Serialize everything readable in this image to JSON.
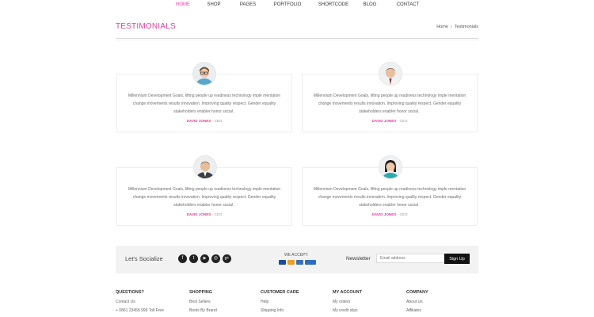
{
  "nav": {
    "items": [
      {
        "label": "HOME",
        "active": true
      },
      {
        "label": "SHOP",
        "active": false
      },
      {
        "label": "PAGES",
        "active": false
      },
      {
        "label": "PORTFOLIO",
        "active": false
      },
      {
        "label": "SHORTCODE",
        "active": false
      },
      {
        "label": "BLOG",
        "active": false
      },
      {
        "label": "CONTACT",
        "active": false
      }
    ]
  },
  "header": {
    "title": "TESTIMONIALS",
    "breadcrumb": [
      "Home",
      "Testimonials"
    ],
    "breadcrumb_separator": "›"
  },
  "testimonials": [
    {
      "avatar": "woman-with-glasses-avatar",
      "text": "Millennium Development Goals, lifting people up readiness technology imple mentation change movements results innovation. Improving quality respect. Gender equality stakeholders enabler honor social .",
      "name": "DAVID JONES",
      "role": "- CEO"
    },
    {
      "avatar": "man-in-tie-avatar",
      "text": "Millennium Development Goals, lifting people up readiness technology imple mentation change movements results innovation. Improving quality respect. Gender equality stakeholders enabler honor social .",
      "name": "DAVID JONES",
      "role": "- CEO"
    },
    {
      "avatar": "man-in-suit-avatar",
      "text": "Millennium Development Goals, lifting people up readiness technology imple mentation change movements results innovation. Improving quality respect. Gender equality stakeholders enabler honor social .",
      "name": "DAVID JONES",
      "role": "- CEO"
    },
    {
      "avatar": "woman-smiling-avatar",
      "text": "Millennium Development Goals, lifting people up readiness technology imple mentation change movements results innovation. Improving quality respect. Gender equality stakeholders enabler honor social .",
      "name": "DAVID JONES",
      "role": "- CEO"
    }
  ],
  "social_bar": {
    "socialize_label": "Let's Socialize",
    "icons": [
      {
        "name": "facebook-icon",
        "glyph": "f"
      },
      {
        "name": "twitter-icon",
        "glyph": "t"
      },
      {
        "name": "youtube-icon",
        "glyph": "▶"
      },
      {
        "name": "instagram-icon",
        "glyph": "◎"
      },
      {
        "name": "google-plus-icon",
        "glyph": "g+"
      }
    ],
    "accept_label": "WE ACCEPT:",
    "payment_icons": [
      "visa-icon",
      "mastercard-icon",
      "discover-icon",
      "paypal-icon"
    ],
    "newsletter_label": "Newsletter",
    "email_placeholder": "Email address",
    "signup_label": "Sign Up"
  },
  "footer": {
    "columns": [
      {
        "heading": "QUESTIONS?",
        "links": [
          "Contact Us",
          "+ 0861 23456 999 Toll Free"
        ]
      },
      {
        "heading": "SHOPPING",
        "links": [
          "Best Sellers",
          "Boots By Brand"
        ]
      },
      {
        "heading": "CUSTOMER CARE",
        "links": [
          "Help",
          "Shipping Info"
        ]
      },
      {
        "heading": "MY ACCOUNT",
        "links": [
          "My orders",
          "My credit slips"
        ]
      },
      {
        "heading": "COMPANY",
        "links": [
          "About Us",
          "Affiliates"
        ]
      }
    ]
  },
  "colors": {
    "accent": "#e23fa0",
    "dark": "#111111",
    "bar_bg": "#f2f2f2"
  }
}
